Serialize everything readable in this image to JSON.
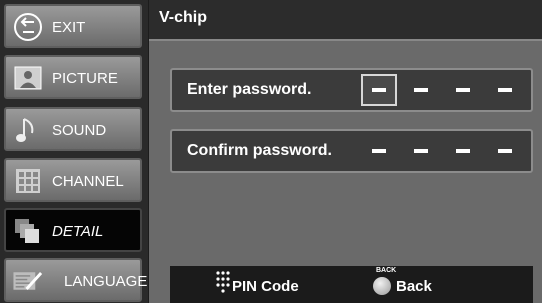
{
  "sidebar": {
    "items": [
      {
        "label": "EXIT",
        "icon": "exit-arrow-icon"
      },
      {
        "label": "PICTURE",
        "icon": "picture-icon"
      },
      {
        "label": "SOUND",
        "icon": "music-note-icon"
      },
      {
        "label": "CHANNEL",
        "icon": "channel-grid-icon"
      },
      {
        "label": "DETAIL",
        "icon": "detail-layers-icon",
        "active": true
      },
      {
        "label": "LANGUAGE",
        "icon": "language-icon"
      }
    ]
  },
  "title": "V-chip",
  "enter_row": {
    "label": "Enter password.",
    "digits": [
      "–",
      "–",
      "–",
      "–"
    ]
  },
  "confirm_row": {
    "label": "Confirm password.",
    "digits": [
      "–",
      "–",
      "–",
      "–"
    ]
  },
  "footer": {
    "pin_label": "PIN Code",
    "back_button_caption": "BACK",
    "back_label": "Back"
  },
  "colors": {
    "active_item_bg": "#050505",
    "panel_bg": "#6a6a6a",
    "row_bg": "#3b3b3b"
  }
}
